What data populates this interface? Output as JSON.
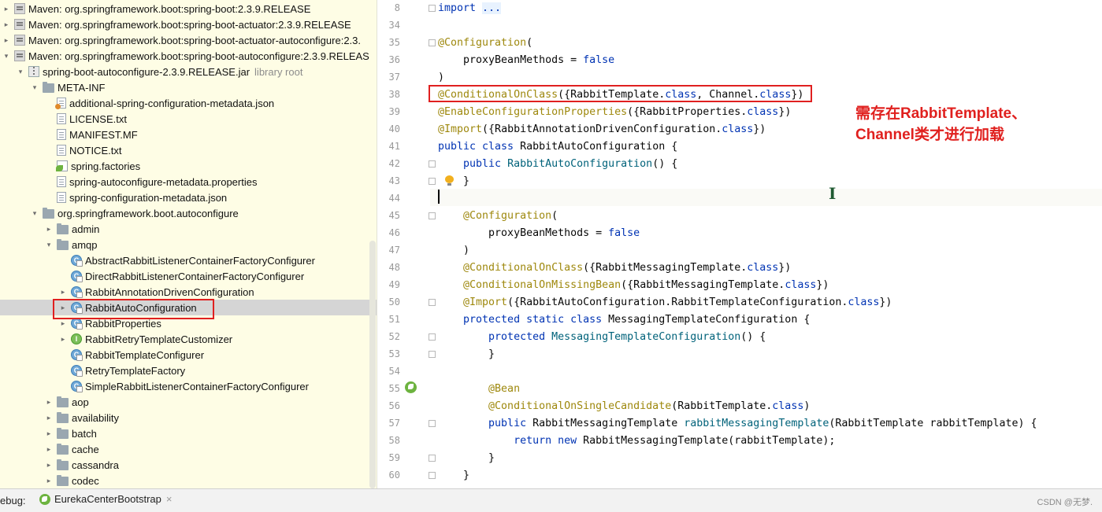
{
  "tree": {
    "rows": [
      {
        "label": "Maven: org.springframework.boot:spring-boot:2.3.9.RELEASE",
        "sub": "",
        "icon": "maven",
        "arrow": "right",
        "indent": 8
      },
      {
        "label": "Maven: org.springframework.boot:spring-boot-actuator:2.3.9.RELEASE",
        "sub": "",
        "icon": "maven",
        "arrow": "right",
        "indent": 8
      },
      {
        "label": "Maven: org.springframework.boot:spring-boot-actuator-autoconfigure:2.3.",
        "sub": "",
        "icon": "maven",
        "arrow": "right",
        "indent": 8
      },
      {
        "label": "Maven: org.springframework.boot:spring-boot-autoconfigure:2.3.9.RELEAS",
        "sub": "",
        "icon": "maven",
        "arrow": "down",
        "indent": 8
      },
      {
        "label": "spring-boot-autoconfigure-2.3.9.RELEASE.jar",
        "sub": "library root",
        "icon": "jar",
        "arrow": "down",
        "indent": 26
      },
      {
        "label": "META-INF",
        "sub": "",
        "icon": "folder",
        "arrow": "down",
        "indent": 44
      },
      {
        "label": "additional-spring-configuration-metadata.json",
        "sub": "",
        "icon": "json",
        "arrow": "",
        "indent": 62
      },
      {
        "label": "LICENSE.txt",
        "sub": "",
        "icon": "file",
        "arrow": "",
        "indent": 62
      },
      {
        "label": "MANIFEST.MF",
        "sub": "",
        "icon": "mf",
        "arrow": "",
        "indent": 62
      },
      {
        "label": "NOTICE.txt",
        "sub": "",
        "icon": "file",
        "arrow": "",
        "indent": 62
      },
      {
        "label": "spring.factories",
        "sub": "",
        "icon": "spring",
        "arrow": "",
        "indent": 62
      },
      {
        "label": "spring-autoconfigure-metadata.properties",
        "sub": "",
        "icon": "file",
        "arrow": "",
        "indent": 62
      },
      {
        "label": "spring-configuration-metadata.json",
        "sub": "",
        "icon": "file",
        "arrow": "",
        "indent": 62
      },
      {
        "label": "org.springframework.boot.autoconfigure",
        "sub": "",
        "icon": "folder",
        "arrow": "down",
        "indent": 44
      },
      {
        "label": "admin",
        "sub": "",
        "icon": "folder",
        "arrow": "right",
        "indent": 62
      },
      {
        "label": "amqp",
        "sub": "",
        "icon": "folder",
        "arrow": "down",
        "indent": 62
      },
      {
        "label": "AbstractRabbitListenerContainerFactoryConfigurer",
        "sub": "",
        "icon": "cls",
        "arrow": "",
        "indent": 80
      },
      {
        "label": "DirectRabbitListenerContainerFactoryConfigurer",
        "sub": "",
        "icon": "cls",
        "arrow": "",
        "indent": 80
      },
      {
        "label": "RabbitAnnotationDrivenConfiguration",
        "sub": "",
        "icon": "cls",
        "arrow": "right",
        "indent": 80
      },
      {
        "label": "RabbitAutoConfiguration",
        "sub": "",
        "icon": "cls",
        "arrow": "right",
        "indent": 80,
        "selected": true
      },
      {
        "label": "RabbitProperties",
        "sub": "",
        "icon": "cls",
        "arrow": "right",
        "indent": 80
      },
      {
        "label": "RabbitRetryTemplateCustomizer",
        "sub": "",
        "icon": "intf",
        "arrow": "right",
        "indent": 80
      },
      {
        "label": "RabbitTemplateConfigurer",
        "sub": "",
        "icon": "cls",
        "arrow": "",
        "indent": 80
      },
      {
        "label": "RetryTemplateFactory",
        "sub": "",
        "icon": "cls",
        "arrow": "",
        "indent": 80
      },
      {
        "label": "SimpleRabbitListenerContainerFactoryConfigurer",
        "sub": "",
        "icon": "cls",
        "arrow": "",
        "indent": 80
      },
      {
        "label": "aop",
        "sub": "",
        "icon": "folder",
        "arrow": "right",
        "indent": 62
      },
      {
        "label": "availability",
        "sub": "",
        "icon": "folder",
        "arrow": "right",
        "indent": 62
      },
      {
        "label": "batch",
        "sub": "",
        "icon": "folder",
        "arrow": "right",
        "indent": 62
      },
      {
        "label": "cache",
        "sub": "",
        "icon": "folder",
        "arrow": "right",
        "indent": 62
      },
      {
        "label": "cassandra",
        "sub": "",
        "icon": "folder",
        "arrow": "right",
        "indent": 62
      },
      {
        "label": "codec",
        "sub": "",
        "icon": "folder",
        "arrow": "right",
        "indent": 62
      }
    ]
  },
  "editor": {
    "lines": [
      {
        "n": "8",
        "fold": true,
        "tokens": [
          [
            "kw",
            "import "
          ],
          [
            "fold-ph",
            "..."
          ]
        ]
      },
      {
        "n": "34",
        "fold": false,
        "tokens": []
      },
      {
        "n": "35",
        "fold": true,
        "tokens": [
          [
            "ann",
            "@Configuration"
          ],
          [
            "sym",
            "("
          ]
        ]
      },
      {
        "n": "36",
        "fold": false,
        "tokens": [
          [
            "sym",
            "    proxyBeanMethods = "
          ],
          [
            "kw",
            "false"
          ]
        ]
      },
      {
        "n": "37",
        "fold": false,
        "tokens": [
          [
            "sym",
            ")"
          ]
        ]
      },
      {
        "n": "38",
        "fold": false,
        "tokens": [
          [
            "ann",
            "@ConditionalOnClass"
          ],
          [
            "sym",
            "({RabbitTemplate."
          ],
          [
            "kw",
            "class"
          ],
          [
            "sym",
            ", Channel."
          ],
          [
            "kw",
            "class"
          ],
          [
            "sym",
            "})"
          ]
        ]
      },
      {
        "n": "39",
        "fold": false,
        "tokens": [
          [
            "ann",
            "@EnableConfigurationProperties"
          ],
          [
            "sym",
            "({RabbitProperties."
          ],
          [
            "kw",
            "class"
          ],
          [
            "sym",
            "})"
          ]
        ]
      },
      {
        "n": "40",
        "fold": false,
        "tokens": [
          [
            "ann",
            "@Import"
          ],
          [
            "sym",
            "({RabbitAnnotationDrivenConfiguration."
          ],
          [
            "kw",
            "class"
          ],
          [
            "sym",
            "})"
          ]
        ]
      },
      {
        "n": "41",
        "fold": false,
        "tokens": [
          [
            "kw",
            "public class "
          ],
          [
            "sym",
            "RabbitAutoConfiguration {"
          ]
        ]
      },
      {
        "n": "42",
        "fold": true,
        "tokens": [
          [
            "kw",
            "    public "
          ],
          [
            "fn",
            "RabbitAutoConfiguration"
          ],
          [
            "sym",
            "() {"
          ]
        ]
      },
      {
        "n": "43",
        "fold": true,
        "tokens": [
          [
            "sym",
            "    }"
          ]
        ]
      },
      {
        "n": "44",
        "fold": false,
        "tokens": []
      },
      {
        "n": "45",
        "fold": true,
        "tokens": [
          [
            "ann",
            "    @Configuration"
          ],
          [
            "sym",
            "("
          ]
        ]
      },
      {
        "n": "46",
        "fold": false,
        "tokens": [
          [
            "sym",
            "        proxyBeanMethods = "
          ],
          [
            "kw",
            "false"
          ]
        ]
      },
      {
        "n": "47",
        "fold": false,
        "tokens": [
          [
            "sym",
            "    )"
          ]
        ]
      },
      {
        "n": "48",
        "fold": false,
        "tokens": [
          [
            "ann",
            "    @ConditionalOnClass"
          ],
          [
            "sym",
            "({RabbitMessagingTemplate."
          ],
          [
            "kw",
            "class"
          ],
          [
            "sym",
            "})"
          ]
        ]
      },
      {
        "n": "49",
        "fold": false,
        "tokens": [
          [
            "ann",
            "    @ConditionalOnMissingBean"
          ],
          [
            "sym",
            "({RabbitMessagingTemplate."
          ],
          [
            "kw",
            "class"
          ],
          [
            "sym",
            "})"
          ]
        ]
      },
      {
        "n": "50",
        "fold": true,
        "tokens": [
          [
            "ann",
            "    @Import"
          ],
          [
            "sym",
            "({RabbitAutoConfiguration.RabbitTemplateConfiguration."
          ],
          [
            "kw",
            "class"
          ],
          [
            "sym",
            "})"
          ]
        ]
      },
      {
        "n": "51",
        "fold": false,
        "tokens": [
          [
            "kw",
            "    protected static class "
          ],
          [
            "sym",
            "MessagingTemplateConfiguration {"
          ]
        ]
      },
      {
        "n": "52",
        "fold": true,
        "tokens": [
          [
            "kw",
            "        protected "
          ],
          [
            "fn",
            "MessagingTemplateConfiguration"
          ],
          [
            "sym",
            "() {"
          ]
        ]
      },
      {
        "n": "53",
        "fold": true,
        "tokens": [
          [
            "sym",
            "        }"
          ]
        ]
      },
      {
        "n": "54",
        "fold": false,
        "tokens": []
      },
      {
        "n": "55",
        "fold": false,
        "tokens": [
          [
            "ann",
            "        @Bean"
          ]
        ]
      },
      {
        "n": "56",
        "fold": false,
        "tokens": [
          [
            "ann",
            "        @ConditionalOnSingleCandidate"
          ],
          [
            "sym",
            "(RabbitTemplate."
          ],
          [
            "kw",
            "class"
          ],
          [
            "sym",
            ")"
          ]
        ]
      },
      {
        "n": "57",
        "fold": true,
        "tokens": [
          [
            "kw",
            "        public "
          ],
          [
            "sym",
            "RabbitMessagingTemplate "
          ],
          [
            "fn",
            "rabbitMessagingTemplate"
          ],
          [
            "sym",
            "(RabbitTemplate rabbitTemplate) {"
          ]
        ]
      },
      {
        "n": "58",
        "fold": false,
        "tokens": [
          [
            "kw",
            "            return new "
          ],
          [
            "sym",
            "RabbitMessagingTemplate(rabbitTemplate);"
          ]
        ]
      },
      {
        "n": "59",
        "fold": true,
        "tokens": [
          [
            "sym",
            "        }"
          ]
        ]
      },
      {
        "n": "60",
        "fold": true,
        "tokens": [
          [
            "sym",
            "    }"
          ]
        ]
      }
    ],
    "annotation_line1": "需存在RabbitTemplate、",
    "annotation_line2": "Channel类才进行加载"
  },
  "bottom": {
    "debug_label": "ebug:",
    "tab_label": "EurekaCenterBootstrap",
    "close_glyph": "×",
    "watermark": "CSDN @无梦."
  },
  "icons": {
    "tree_arrow_right": "▸",
    "tree_arrow_down": "▾",
    "cursor": "I"
  }
}
